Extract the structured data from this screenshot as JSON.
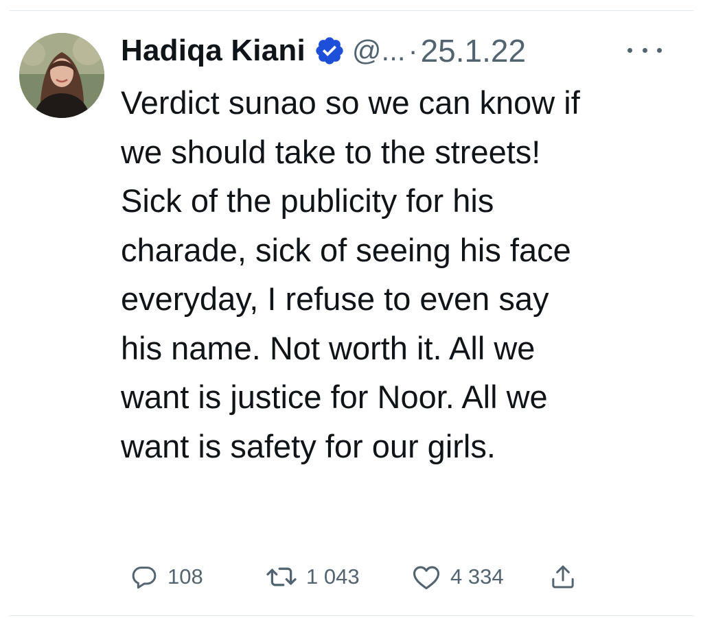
{
  "tweet": {
    "display_name": "Hadiqa Kiani",
    "verified_icon": "verified-badge-icon",
    "handle": "@...",
    "separator": "·",
    "date": "25.1.22",
    "more_icon": "more-horizontal-icon",
    "body_lines": [
      "Verdict sunao so we can know if",
      "we should take to the streets!",
      "Sick of the publicity for his",
      "charade, sick of seeing his face",
      "everyday, I refuse to even say",
      "his name. Not worth it. All we",
      "want is justice for Noor. All we",
      "want is safety for our girls."
    ]
  },
  "actions": {
    "reply": {
      "icon": "reply-icon",
      "count": "108"
    },
    "retweet": {
      "icon": "retweet-icon",
      "count": "1 043"
    },
    "like": {
      "icon": "heart-icon",
      "count": "4 334"
    },
    "share": {
      "icon": "share-icon"
    }
  },
  "colors": {
    "text": "#0f1419",
    "secondary": "#536471",
    "verified": "#1d4fd8",
    "divider": "#e1e8ed"
  }
}
